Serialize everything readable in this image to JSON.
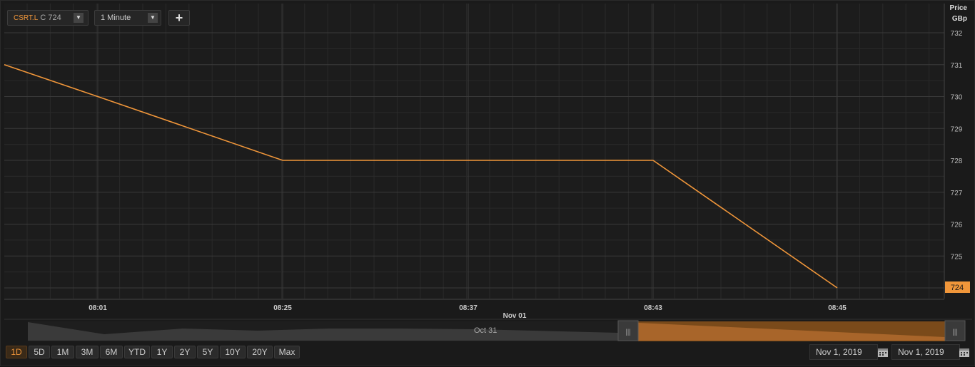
{
  "toolbar": {
    "symbol": "CSRT.L",
    "close_label": "C",
    "close_value": "724",
    "interval": "1 Minute",
    "add_label": "+",
    "dropdown_icon": "dropdown-arrow-icon"
  },
  "price_axis": {
    "title_line1": "Price",
    "title_line2": "GBp",
    "current_value": "724"
  },
  "time_axis": {
    "date_label": "Nov 01"
  },
  "navigator": {
    "label": "Oct 31",
    "shade_color": "#f0963a"
  },
  "ranges": {
    "items": [
      "1D",
      "5D",
      "1M",
      "3M",
      "6M",
      "YTD",
      "1Y",
      "2Y",
      "5Y",
      "10Y",
      "20Y",
      "Max"
    ],
    "active": "1D"
  },
  "date_range": {
    "start": "Nov 1, 2019",
    "end": "Nov 1, 2019"
  },
  "colors": {
    "line": "#f0963a",
    "background": "#1a1a1a",
    "grid": "#333333"
  },
  "chart_data": {
    "type": "line",
    "series": [
      {
        "x": [
          "07:56",
          "08:01",
          "08:25",
          "08:43",
          "08:45"
        ],
        "y": [
          731,
          730,
          728,
          728,
          724
        ]
      }
    ],
    "x_ticks": [
      "08:01",
      "08:25",
      "08:37",
      "08:43",
      "08:45"
    ],
    "y_ticks": [
      724,
      725,
      726,
      727,
      728,
      729,
      730,
      731,
      732
    ],
    "ylim": [
      723.7,
      732.2
    ],
    "ylabel": "Price GBp",
    "grid": true,
    "legend": "none"
  }
}
